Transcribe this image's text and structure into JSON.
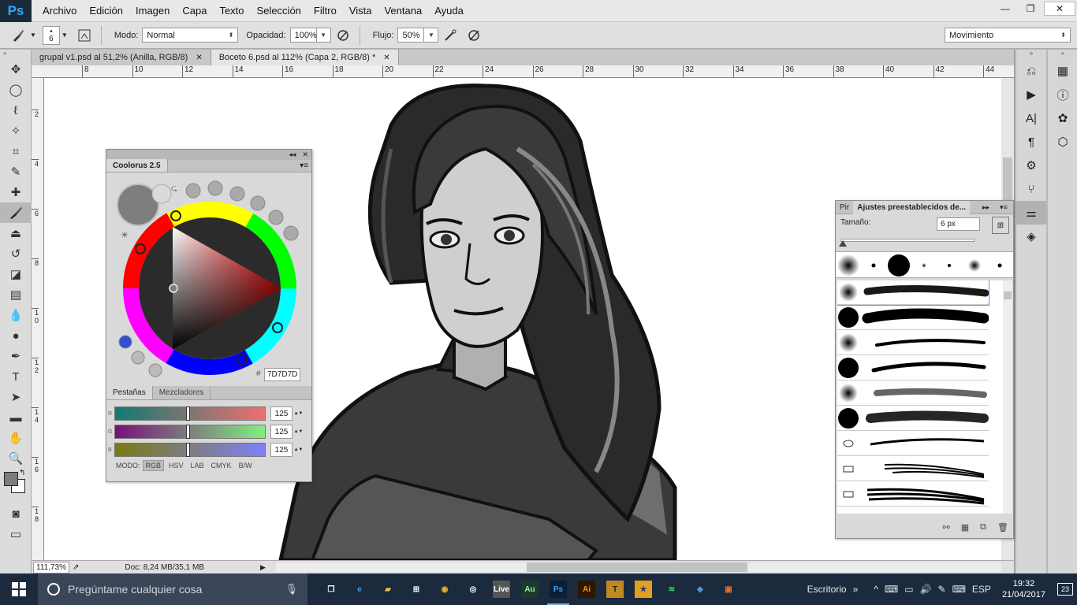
{
  "app": {
    "logo": "Ps",
    "menu": [
      "Archivo",
      "Edición",
      "Imagen",
      "Capa",
      "Texto",
      "Selección",
      "Filtro",
      "Vista",
      "Ventana",
      "Ayuda"
    ],
    "window_controls": {
      "minimize": "—",
      "restore": "❐",
      "close": "✕"
    }
  },
  "options": {
    "brush_size": "6",
    "mode_label": "Modo:",
    "mode_value": "Normal",
    "opacity_label": "Opacidad:",
    "opacity_value": "100%",
    "flow_label": "Flujo:",
    "flow_value": "50%",
    "workspace_value": "Movimiento"
  },
  "tabs": [
    {
      "label": "grupal v1.psd al 51,2% (Anilla, RGB/8)",
      "close": "✕"
    },
    {
      "label": "Boceto 6.psd al 112% (Capa 2, RGB/8) *",
      "close": "✕"
    }
  ],
  "ruler_h": [
    "8",
    "10",
    "12",
    "14",
    "16",
    "18",
    "20",
    "22",
    "24",
    "26",
    "28",
    "30",
    "32",
    "34",
    "36",
    "38",
    "40",
    "42",
    "44"
  ],
  "ruler_v": [
    "2",
    "4",
    "6",
    "8",
    "1 0",
    "1 2",
    "1 4",
    "1 6",
    "1 8"
  ],
  "status": {
    "zoom": "111,73%",
    "doc": "Doc: 8,24 MB/35,1 MB"
  },
  "coolorus": {
    "title": "Coolorus 2.5",
    "hash": "#",
    "hex": "7D7D7D",
    "tabs": [
      "Pestañas",
      "Mezcladores"
    ],
    "sliders": [
      {
        "channel": "R",
        "value": "125",
        "from": "#0f7a74",
        "to": "#f07070"
      },
      {
        "channel": "G",
        "value": "125",
        "from": "#7a107a",
        "to": "#80f080"
      },
      {
        "channel": "B",
        "value": "125",
        "from": "#7a7a10",
        "to": "#7f80f8"
      }
    ],
    "mode_label": "MODO:",
    "modes": [
      "RGB",
      "HSV",
      "LAB",
      "CMYK",
      "B/W"
    ]
  },
  "brush_panel": {
    "tab_short": "Pir",
    "tab_active": "Ajustes preestablecidos de...",
    "size_label": "Tamaño:",
    "size_value": "6 px"
  },
  "taskbar": {
    "search_placeholder": "Pregúntame cualquier cosa",
    "apps": [
      {
        "name": "task-view",
        "glyph": "❐",
        "bg": "transparent",
        "fg": "#ffffff"
      },
      {
        "name": "edge",
        "glyph": "e",
        "bg": "transparent",
        "fg": "#3a9be8"
      },
      {
        "name": "file-explorer",
        "glyph": "▰",
        "bg": "transparent",
        "fg": "#f0c040"
      },
      {
        "name": "store",
        "glyph": "⊞",
        "bg": "transparent",
        "fg": "#ffffff"
      },
      {
        "name": "chrome",
        "glyph": "◉",
        "bg": "transparent",
        "fg": "#e8c020"
      },
      {
        "name": "groove",
        "glyph": "◎",
        "bg": "transparent",
        "fg": "#ffffff"
      },
      {
        "name": "live",
        "glyph": "Live",
        "bg": "#555555",
        "fg": "#ffffff"
      },
      {
        "name": "audition",
        "glyph": "Au",
        "bg": "#1d3b28",
        "fg": "#8ff0a8"
      },
      {
        "name": "photoshop",
        "glyph": "Ps",
        "bg": "#0b2033",
        "fg": "#31a8ff"
      },
      {
        "name": "illustrator",
        "glyph": "Ai",
        "bg": "#2e1600",
        "fg": "#ff9a00"
      },
      {
        "name": "app-tools",
        "glyph": "T",
        "bg": "#c08a20",
        "fg": "#1a1a1a"
      },
      {
        "name": "app-game",
        "glyph": "★",
        "bg": "#e0a020",
        "fg": "#2a3a80"
      },
      {
        "name": "spotify",
        "glyph": "≋",
        "bg": "transparent",
        "fg": "#1ed760"
      },
      {
        "name": "app-blue",
        "glyph": "◈",
        "bg": "transparent",
        "fg": "#5a9ae8"
      },
      {
        "name": "app-orange",
        "glyph": "▣",
        "bg": "transparent",
        "fg": "#e8702a"
      }
    ],
    "desktop_label": "Escritorio",
    "lang": "ESP",
    "time": "19:32",
    "date": "21/04/2017",
    "notifications": "23"
  }
}
